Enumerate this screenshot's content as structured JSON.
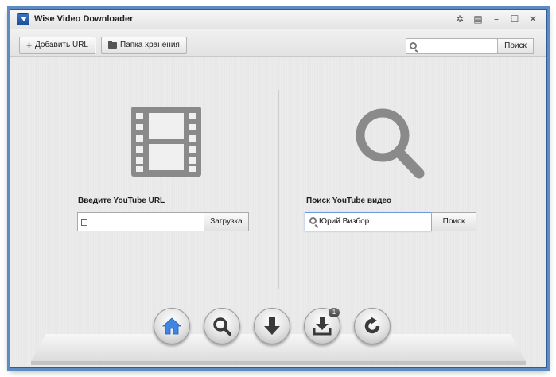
{
  "app": {
    "title": "Wise Video Downloader"
  },
  "window_controls": [
    {
      "name": "settings-icon",
      "glyph": "✲"
    },
    {
      "name": "menu-icon",
      "glyph": "▤"
    },
    {
      "name": "minimize-icon",
      "glyph": "–"
    },
    {
      "name": "maximize-icon",
      "glyph": "☐"
    },
    {
      "name": "close-icon",
      "glyph": "✕"
    }
  ],
  "toolbar": {
    "add_url_label": "Добавить URL",
    "add_url_icon": "+",
    "folder_label": "Папка хранения",
    "search_value": "",
    "search_button": "Поиск"
  },
  "left_panel": {
    "title": "Введите YouTube URL",
    "input_value": "",
    "button_label": "Загрузка"
  },
  "right_panel": {
    "title": "Поиск YouTube видео",
    "input_value": "Юрий Визбор",
    "button_label": "Поиск"
  },
  "dock": {
    "items": [
      "home-icon",
      "search-icon",
      "download-icon",
      "downloads-list-icon",
      "refresh-icon"
    ],
    "active": "home-icon",
    "downloads_badge": "1"
  },
  "colors": {
    "accent": "#3e86e6",
    "icon_gray": "#8a8a8a",
    "dock_icon": "#3a3a3a",
    "window_border": "#5e8cc2"
  }
}
